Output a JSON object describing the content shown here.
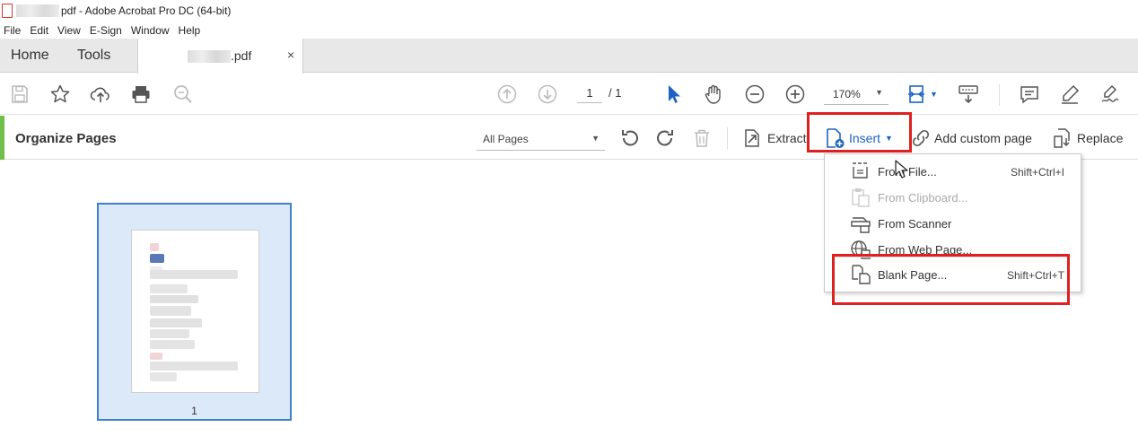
{
  "window": {
    "title": "pdf - Adobe Acrobat Pro DC (64-bit)"
  },
  "menu": [
    "File",
    "Edit",
    "View",
    "E-Sign",
    "Window",
    "Help"
  ],
  "tabs": {
    "home": "Home",
    "tools": "Tools",
    "document": ".pdf",
    "close": "×"
  },
  "toolbar": {
    "page_current": "1",
    "page_total": "/ 1",
    "zoom": "170%",
    "icons": [
      "save-icon",
      "bookmark-star-icon",
      "upload-cloud-icon",
      "print-icon",
      "zoom-search-icon",
      "page-up-icon",
      "page-down-icon",
      "select-cursor-icon",
      "hand-icon",
      "zoom-out-icon",
      "zoom-in-icon",
      "fit-page-icon",
      "scroll-mode-icon",
      "comment-icon",
      "highlight-pen-icon",
      "sign-icon"
    ]
  },
  "organize": {
    "title": "Organize Pages",
    "page_range": "All Pages",
    "extract": "Extract",
    "insert": "Insert",
    "add_custom_page": "Add custom page",
    "replace": "Replace"
  },
  "insert_menu": {
    "items": [
      {
        "label": "From File...",
        "shortcut": "Shift+Ctrl+I",
        "enabled": true
      },
      {
        "label": "From Clipboard...",
        "shortcut": "",
        "enabled": false
      },
      {
        "label": "From Scanner",
        "shortcut": "",
        "enabled": true
      },
      {
        "label": "From Web Page...",
        "shortcut": "",
        "enabled": true
      },
      {
        "label": "Blank Page...",
        "shortcut": "Shift+Ctrl+T",
        "enabled": true
      }
    ]
  },
  "thumbnail": {
    "page_number": "1"
  },
  "colors": {
    "accent_green": "#6fbf4a",
    "insert_blue": "#1d62c4",
    "highlight_red": "#e02020",
    "selection_blue": "#3d7fd1"
  }
}
